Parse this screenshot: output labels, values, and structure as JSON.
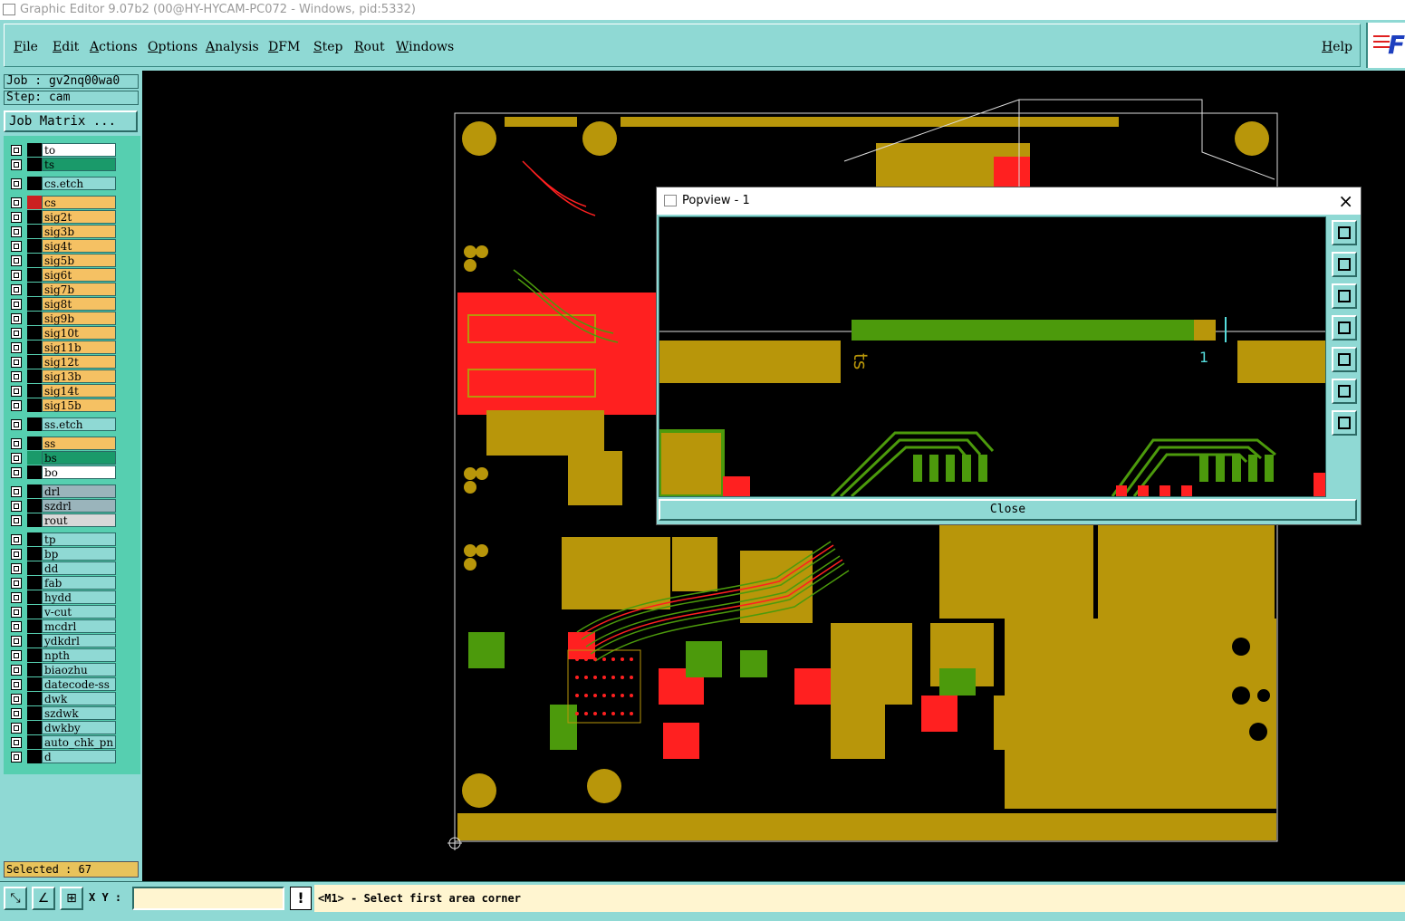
{
  "window": {
    "title": "Graphic Editor 9.07b2 (00@HY-HYCAM-PC072 - Windows, pid:5332)"
  },
  "menu": {
    "items": [
      "File",
      "Edit",
      "Actions",
      "Options",
      "Analysis",
      "DFM",
      "Step",
      "Rout",
      "Windows"
    ],
    "help": "Help"
  },
  "job": {
    "label": "Job : gv2nq00wa0",
    "step": "Step: cam",
    "matrix_button": "Job Matrix ..."
  },
  "layers": [
    {
      "name": "to",
      "color": "#ffffff",
      "swatch": "#000000"
    },
    {
      "name": "ts",
      "color": "#1a9a6a",
      "swatch": "#000000"
    },
    {
      "name": "cs.etch",
      "color": "#8fd9d4",
      "swatch": "#000000"
    },
    {
      "name": "cs",
      "color": "#f5c163",
      "swatch": "#cc2020"
    },
    {
      "name": "sig2t",
      "color": "#f5c163",
      "swatch": "#000000"
    },
    {
      "name": "sig3b",
      "color": "#f5c163",
      "swatch": "#000000"
    },
    {
      "name": "sig4t",
      "color": "#f5c163",
      "swatch": "#000000"
    },
    {
      "name": "sig5b",
      "color": "#f5c163",
      "swatch": "#000000"
    },
    {
      "name": "sig6t",
      "color": "#f5c163",
      "swatch": "#000000"
    },
    {
      "name": "sig7b",
      "color": "#f5c163",
      "swatch": "#000000"
    },
    {
      "name": "sig8t",
      "color": "#f5c163",
      "swatch": "#000000"
    },
    {
      "name": "sig9b",
      "color": "#f5c163",
      "swatch": "#000000"
    },
    {
      "name": "sig10t",
      "color": "#f5c163",
      "swatch": "#000000"
    },
    {
      "name": "sig11b",
      "color": "#f5c163",
      "swatch": "#000000"
    },
    {
      "name": "sig12t",
      "color": "#f5c163",
      "swatch": "#000000"
    },
    {
      "name": "sig13b",
      "color": "#f5c163",
      "swatch": "#000000"
    },
    {
      "name": "sig14t",
      "color": "#f5c163",
      "swatch": "#000000"
    },
    {
      "name": "sig15b",
      "color": "#f5c163",
      "swatch": "#000000"
    },
    {
      "name": "ss.etch",
      "color": "#8fd9d4",
      "swatch": "#000000"
    },
    {
      "name": "ss",
      "color": "#f5c163",
      "swatch": "#000000"
    },
    {
      "name": "bs",
      "color": "#1a9a6a",
      "swatch": "#1a9a6a"
    },
    {
      "name": "bo",
      "color": "#ffffff",
      "swatch": "#000000"
    },
    {
      "name": "drl",
      "color": "#9ab4bb",
      "swatch": "#000000"
    },
    {
      "name": "szdrl",
      "color": "#9ab4bb",
      "swatch": "#000000"
    },
    {
      "name": "rout",
      "color": "#d8d8d8",
      "swatch": "#000000"
    },
    {
      "name": "tp",
      "color": "#8fd9d4",
      "swatch": "#000000"
    },
    {
      "name": "bp",
      "color": "#8fd9d4",
      "swatch": "#000000"
    },
    {
      "name": "dd",
      "color": "#8fd9d4",
      "swatch": "#000000"
    },
    {
      "name": "fab",
      "color": "#8fd9d4",
      "swatch": "#000000"
    },
    {
      "name": "hydd",
      "color": "#8fd9d4",
      "swatch": "#000000"
    },
    {
      "name": "v-cut",
      "color": "#8fd9d4",
      "swatch": "#000000"
    },
    {
      "name": "mcdrl",
      "color": "#8fd9d4",
      "swatch": "#000000"
    },
    {
      "name": "ydkdrl",
      "color": "#8fd9d4",
      "swatch": "#000000"
    },
    {
      "name": "npth",
      "color": "#8fd9d4",
      "swatch": "#000000"
    },
    {
      "name": "biaozhu",
      "color": "#8fd9d4",
      "swatch": "#000000"
    },
    {
      "name": "datecode-ss",
      "color": "#8fd9d4",
      "swatch": "#000000"
    },
    {
      "name": "dwk",
      "color": "#8fd9d4",
      "swatch": "#000000"
    },
    {
      "name": "szdwk",
      "color": "#8fd9d4",
      "swatch": "#000000"
    },
    {
      "name": "dwkby",
      "color": "#8fd9d4",
      "swatch": "#000000"
    },
    {
      "name": "auto_chk_pn",
      "color": "#8fd9d4",
      "swatch": "#000000"
    },
    {
      "name": "d",
      "color": "#8fd9d4",
      "swatch": "#000000"
    }
  ],
  "status": {
    "selected": "Selected : 67"
  },
  "bottombar": {
    "xy_label": "X Y :",
    "xy_value": "",
    "message": "<M1> - Select first area corner"
  },
  "popview": {
    "title": "Popview - 1",
    "close": "Close",
    "text_marks": [
      "1",
      "ts"
    ]
  },
  "colors": {
    "gold": "#b8960a",
    "red": "#ff2020",
    "green": "#4c9a0c",
    "panel": "#8fd9d4",
    "layers": "#56cfb0"
  }
}
